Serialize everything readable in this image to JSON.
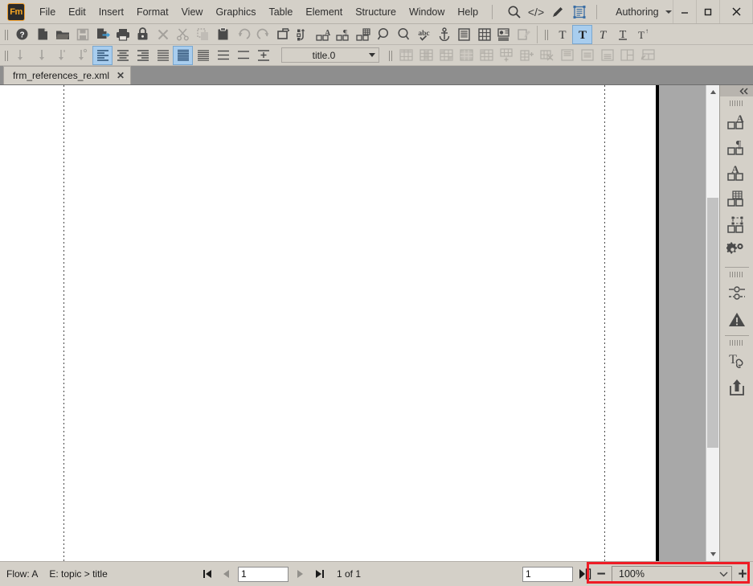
{
  "app": {
    "name": "Adobe FrameMaker",
    "logo_text": "Fm",
    "workspace": "Authoring",
    "accent_color": "#f5a623",
    "annotation_color": "#ee1c25",
    "highlight_color": "#a8cdee"
  },
  "menubar": {
    "items": [
      {
        "label": "File",
        "name": "menu-file"
      },
      {
        "label": "Edit",
        "name": "menu-edit"
      },
      {
        "label": "Insert",
        "name": "menu-insert"
      },
      {
        "label": "Format",
        "name": "menu-format"
      },
      {
        "label": "View",
        "name": "menu-view"
      },
      {
        "label": "Graphics",
        "name": "menu-graphics"
      },
      {
        "label": "Table",
        "name": "menu-table"
      },
      {
        "label": "Element",
        "name": "menu-element"
      },
      {
        "label": "Structure",
        "name": "menu-structure"
      },
      {
        "label": "Window",
        "name": "menu-window"
      },
      {
        "label": "Help",
        "name": "menu-help"
      }
    ],
    "quick_icons": [
      "search-icon",
      "xml-code-view-icon",
      "author-view-icon",
      "wysiwyg-view-icon"
    ],
    "window_controls": [
      "minimize",
      "maximize",
      "close"
    ]
  },
  "toolbar_main": {
    "items": [
      {
        "name": "help-button",
        "icon": "question-mark-icon",
        "enabled": true
      },
      {
        "name": "new-document-button",
        "icon": "new-file-icon",
        "enabled": true
      },
      {
        "name": "open-document-button",
        "icon": "folder-open-icon",
        "enabled": true
      },
      {
        "name": "save-button",
        "icon": "floppy-disk-icon",
        "enabled": false
      },
      {
        "name": "save-as-button",
        "icon": "file-arrow-icon",
        "enabled": true
      },
      {
        "name": "print-button",
        "icon": "printer-icon",
        "enabled": true
      },
      {
        "name": "lock-button",
        "icon": "padlock-icon",
        "enabled": true
      },
      {
        "name": "delete-button",
        "icon": "x-cross-icon",
        "enabled": false
      },
      {
        "name": "cut-button",
        "icon": "scissors-icon",
        "enabled": false
      },
      {
        "name": "copy-button",
        "icon": "copy-icon",
        "enabled": false
      },
      {
        "name": "paste-button",
        "icon": "clipboard-icon",
        "enabled": true
      },
      {
        "name": "undo-button",
        "icon": "undo-arrow-icon",
        "enabled": false
      },
      {
        "name": "redo-button",
        "icon": "redo-arrow-icon",
        "enabled": false
      },
      {
        "name": "insert-element-button",
        "icon": "element-box-icon",
        "enabled": true
      },
      {
        "name": "wrap-element-button",
        "icon": "wrap-element-icon",
        "enabled": true
      },
      {
        "name": "character-designer-button",
        "icon": "character-format-icon",
        "enabled": true
      },
      {
        "name": "paragraph-designer-button",
        "icon": "paragraph-format-icon",
        "enabled": true
      },
      {
        "name": "table-designer-button",
        "icon": "table-format-icon",
        "enabled": true
      },
      {
        "name": "zoom-out-view-button",
        "icon": "magnifier-minus-icon",
        "enabled": true
      },
      {
        "name": "zoom-in-view-button",
        "icon": "magnifier-plus-icon",
        "enabled": true
      },
      {
        "name": "spell-check-button",
        "icon": "abc-check-icon",
        "enabled": true
      },
      {
        "name": "anchored-frame-button",
        "icon": "anchor-icon",
        "enabled": true
      },
      {
        "name": "text-frame-button",
        "icon": "text-frame-icon",
        "enabled": true
      },
      {
        "name": "insert-table-button",
        "icon": "grid-table-icon",
        "enabled": true
      },
      {
        "name": "footnote-button",
        "icon": "footnote-icon",
        "enabled": true
      },
      {
        "name": "track-changes-button",
        "icon": "track-changes-icon",
        "enabled": false
      }
    ],
    "text_style_items": [
      {
        "name": "plain-text-button",
        "icon": "plain-T-icon",
        "active": false
      },
      {
        "name": "bold-button",
        "icon": "bold-T-icon",
        "active": true
      },
      {
        "name": "italic-button",
        "icon": "italic-T-icon",
        "active": false
      },
      {
        "name": "underline-button",
        "icon": "underline-T-icon",
        "active": false
      },
      {
        "name": "superscript-button",
        "icon": "superscript-T-icon",
        "active": false
      }
    ]
  },
  "toolbar_paragraph": {
    "spacing_items": [
      {
        "name": "line-spacing-single-button",
        "icon": "arrow-down-single-icon",
        "enabled": false
      },
      {
        "name": "line-spacing-onehalf-button",
        "icon": "arrow-down-onehalf-icon",
        "enabled": false
      },
      {
        "name": "line-spacing-double-button",
        "icon": "arrow-down-double-icon",
        "enabled": false
      },
      {
        "name": "line-spacing-custom-button",
        "icon": "arrow-down-custom-icon",
        "enabled": false
      }
    ],
    "align_items": [
      {
        "name": "align-left-button",
        "icon": "align-left-icon",
        "active": true
      },
      {
        "name": "align-center-button",
        "icon": "align-center-icon",
        "active": false
      },
      {
        "name": "align-right-button",
        "icon": "align-right-icon",
        "active": false
      },
      {
        "name": "align-justify-button",
        "icon": "align-justify-icon",
        "active": false
      },
      {
        "name": "spacing-none-button",
        "icon": "spacing-none-icon",
        "active": true
      },
      {
        "name": "spacing-small-button",
        "icon": "spacing-small-icon",
        "active": false
      },
      {
        "name": "spacing-medium-button",
        "icon": "spacing-medium-icon",
        "active": false
      },
      {
        "name": "spacing-large-button",
        "icon": "spacing-large-icon",
        "active": false
      },
      {
        "name": "indent-button",
        "icon": "indent-icon",
        "active": false
      }
    ],
    "paragraph_format": {
      "value": "title.0",
      "label": "paragraph-format-selector"
    },
    "table_items": [
      {
        "name": "insert-table-tool-button",
        "icon": "table-insert-icon",
        "enabled": false
      },
      {
        "name": "table-row-shade-button",
        "icon": "table-shade-icon",
        "enabled": false
      },
      {
        "name": "table-column-button",
        "icon": "table-column-icon",
        "enabled": false
      },
      {
        "name": "table-fill-button",
        "icon": "table-fill-icon",
        "enabled": false
      },
      {
        "name": "table-grid-button",
        "icon": "table-grid-icon",
        "enabled": false
      },
      {
        "name": "add-row-button",
        "icon": "table-add-row-icon",
        "enabled": false
      },
      {
        "name": "add-column-button",
        "icon": "table-add-column-icon",
        "enabled": false
      },
      {
        "name": "cut-table-cells-button",
        "icon": "table-scissors-icon",
        "enabled": false
      },
      {
        "name": "cell-align-top-button",
        "icon": "cell-align-top-icon",
        "enabled": false
      },
      {
        "name": "cell-align-middle-button",
        "icon": "cell-align-middle-icon",
        "enabled": false
      },
      {
        "name": "cell-align-bottom-button",
        "icon": "cell-align-bottom-icon",
        "enabled": false
      },
      {
        "name": "split-cells-button",
        "icon": "split-cells-icon",
        "enabled": false
      },
      {
        "name": "merge-cells-button",
        "icon": "merge-cells-icon",
        "enabled": false
      }
    ]
  },
  "document_tab": {
    "filename": "frm_references_re.xml",
    "close_label": "✕"
  },
  "dock": {
    "collapse_label": "«",
    "items": [
      {
        "name": "dock-character-designer",
        "icon": "character-designer-icon"
      },
      {
        "name": "dock-paragraph-designer",
        "icon": "paragraph-designer-icon"
      },
      {
        "name": "dock-font-designer",
        "icon": "font-designer-icon"
      },
      {
        "name": "dock-table-designer",
        "icon": "table-designer-icon"
      },
      {
        "name": "dock-object-designer",
        "icon": "object-designer-icon"
      },
      {
        "name": "dock-settings",
        "icon": "gears-icon"
      },
      {
        "name": "dock-conditional-text",
        "icon": "conditional-text-icon"
      },
      {
        "name": "dock-validate",
        "icon": "warning-triangle-icon"
      },
      {
        "name": "dock-cross-reference",
        "icon": "cross-reference-icon"
      },
      {
        "name": "dock-publish",
        "icon": "publish-upload-icon"
      }
    ]
  },
  "statusbar": {
    "flow_label": "Flow: A",
    "element_path": "E: topic > title",
    "first_page_button": "first-page-icon",
    "prev_page_button": "previous-page-icon",
    "page_value": "1",
    "next_page_button": "next-page-icon",
    "last_page_button": "last-page-icon",
    "page_count": "1 of 1",
    "goto_value": "1",
    "goto_button": "goto-page-icon",
    "zoom_minus": "−",
    "zoom_value": "100%",
    "zoom_plus": "+"
  }
}
